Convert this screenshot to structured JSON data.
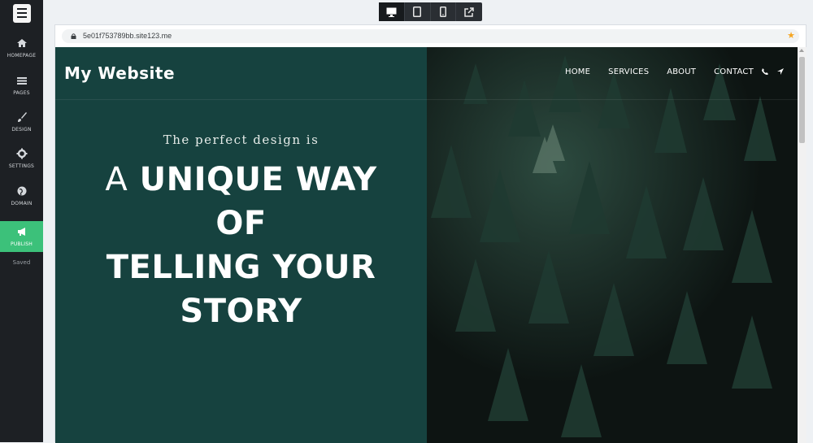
{
  "sidebar": {
    "items": [
      {
        "label": "HOMEPAGE",
        "icon": "home-icon"
      },
      {
        "label": "PAGES",
        "icon": "pages-icon"
      },
      {
        "label": "DESIGN",
        "icon": "brush-icon"
      },
      {
        "label": "SETTINGS",
        "icon": "gear-icon"
      },
      {
        "label": "DOMAIN",
        "icon": "globe-icon"
      },
      {
        "label": "PUBLISH",
        "icon": "megaphone-icon"
      }
    ],
    "status": "Saved"
  },
  "devicebar": {
    "buttons": [
      "desktop-icon",
      "tablet-icon",
      "mobile-icon",
      "external-link-icon"
    ],
    "active": "desktop"
  },
  "browser": {
    "url": "5e01f753789bb.site123.me"
  },
  "site": {
    "title": "My Website",
    "nav": [
      "HOME",
      "SERVICES",
      "ABOUT",
      "CONTACT"
    ],
    "tagline": "The perfect design is",
    "headline": {
      "light": "A",
      "bold_1": "UNIQUE WAY",
      "line_2": "OF",
      "line_3": "TELLING YOUR",
      "line_4": "STORY"
    }
  },
  "colors": {
    "sidebar_bg": "#1d2024",
    "publish_bg": "#3cc17a",
    "hero_left": "#16423f",
    "hero_right": "#0f1614",
    "star": "#f5a623"
  }
}
